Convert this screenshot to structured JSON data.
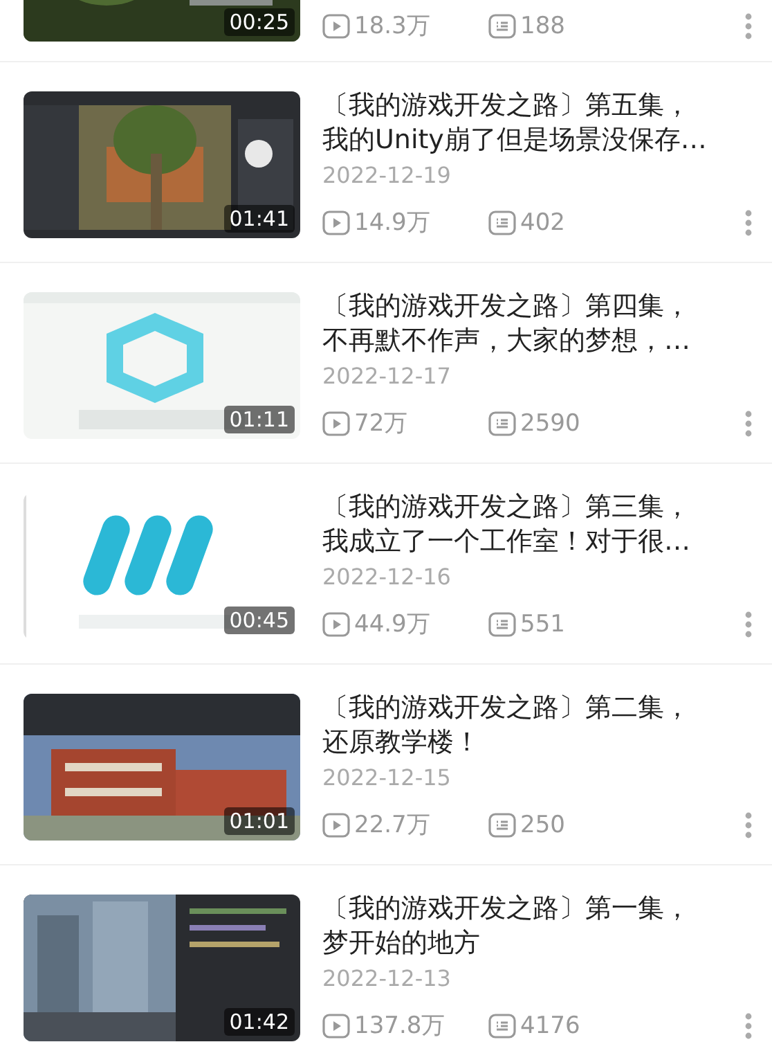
{
  "videos": [
    {
      "kind": "cut",
      "thumbnail": {
        "kind": "picture",
        "duration": "00:25"
      },
      "views": "18.3万",
      "comments": "188"
    },
    {
      "kind": "full",
      "thumbnail": {
        "kind": "picture",
        "duration": "01:41"
      },
      "title": "〔我的游戏开发之路〕第五集，我的Unity崩了但是场景没保存…",
      "date": "2022-12-19",
      "views": "14.9万",
      "comments": "402"
    },
    {
      "kind": "full",
      "thumbnail": {
        "kind": "picture",
        "duration": "01:11"
      },
      "title": "〔我的游戏开发之路〕第四集，不再默不作声，大家的梦想，…",
      "date": "2022-12-17",
      "views": "72万",
      "comments": "2590"
    },
    {
      "kind": "full",
      "thumbnail": {
        "kind": "picture",
        "duration": "00:45"
      },
      "title": "〔我的游戏开发之路〕第三集，我成立了一个工作室！对于很…",
      "date": "2022-12-16",
      "views": "44.9万",
      "comments": "551"
    },
    {
      "kind": "full",
      "thumbnail": {
        "kind": "picture",
        "duration": "01:01"
      },
      "title": "〔我的游戏开发之路〕第二集，还原教学楼！",
      "date": "2022-12-15",
      "views": "22.7万",
      "comments": "250"
    },
    {
      "kind": "full",
      "thumbnail": {
        "kind": "picture",
        "duration": "01:42"
      },
      "title": "〔我的游戏开发之路〕第一集，梦开始的地方",
      "date": "2022-12-13",
      "views": "137.8万",
      "comments": "4176"
    }
  ]
}
